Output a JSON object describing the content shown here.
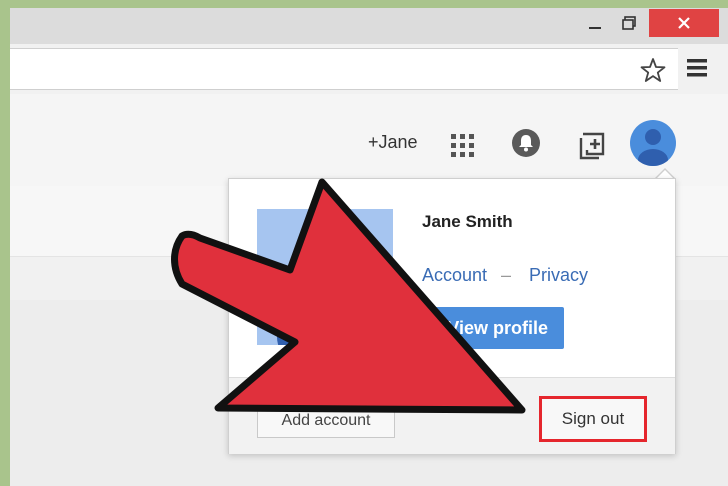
{
  "header": {
    "plus_name": "+Jane"
  },
  "profile_popup": {
    "name": "Jane Smith",
    "account_link": "Account",
    "separator": "–",
    "privacy_link": "Privacy",
    "view_profile_button": "View profile",
    "add_account_button": "Add account",
    "sign_out_button": "Sign out"
  },
  "icons": {
    "window": [
      "minimize-icon",
      "maximize-icon",
      "close-icon"
    ],
    "toolbar": [
      "star-icon",
      "menu-icon"
    ],
    "appbar": [
      "apps-grid-icon",
      "notification-bell-icon",
      "share-plus-icon",
      "avatar-icon"
    ]
  },
  "colors": {
    "accent_blue": "#4a8ddc",
    "link_blue": "#3a6cb5",
    "highlight_red": "#e5262d",
    "arrow_red": "#e0303c",
    "close_button_red": "#e04343"
  }
}
